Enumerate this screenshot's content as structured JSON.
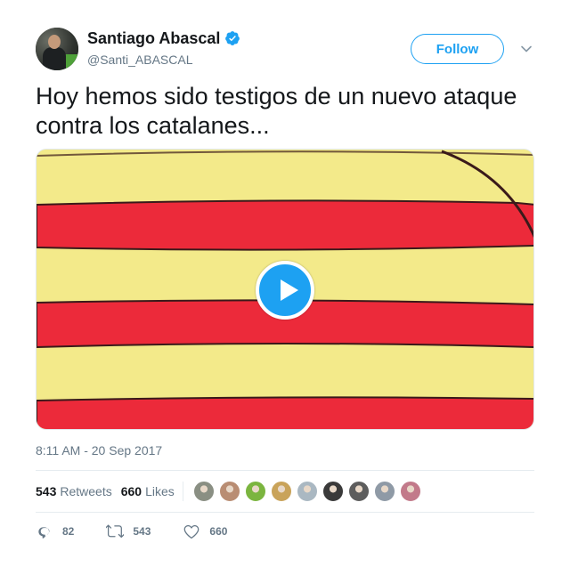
{
  "user": {
    "name": "Santiago Abascal",
    "handle": "@Santi_ABASCAL",
    "verified": true
  },
  "follow_button": {
    "label": "Follow"
  },
  "tweet": {
    "text": "Hoy hemos sido testigos de un nuevo ataque contra los catalanes...",
    "timestamp": "8:11 AM - 20 Sep 2017",
    "media": {
      "type": "video",
      "subject": "senyera flag"
    }
  },
  "stats": {
    "retweets_count": "543",
    "retweets_label": "Retweets",
    "likes_count": "660",
    "likes_label": "Likes"
  },
  "likers": [
    {
      "name": "liker-1",
      "color": "#8a8f83"
    },
    {
      "name": "liker-2",
      "color": "#b98d73"
    },
    {
      "name": "liker-3",
      "color": "#7bb53f"
    },
    {
      "name": "liker-4",
      "color": "#c9a35a"
    },
    {
      "name": "liker-5",
      "color": "#aab8c2"
    },
    {
      "name": "liker-6",
      "color": "#3a3a3a"
    },
    {
      "name": "liker-7",
      "color": "#5d5d5d"
    },
    {
      "name": "liker-8",
      "color": "#8f9aa6"
    },
    {
      "name": "liker-9",
      "color": "#c27a8a"
    }
  ],
  "actions": {
    "replies": "82",
    "retweets": "543",
    "likes": "660"
  },
  "colors": {
    "accent": "#1da1f2",
    "secondary_text": "#657786",
    "flag_yellow": "#f3ea8a",
    "flag_red": "#ec2a3a"
  }
}
